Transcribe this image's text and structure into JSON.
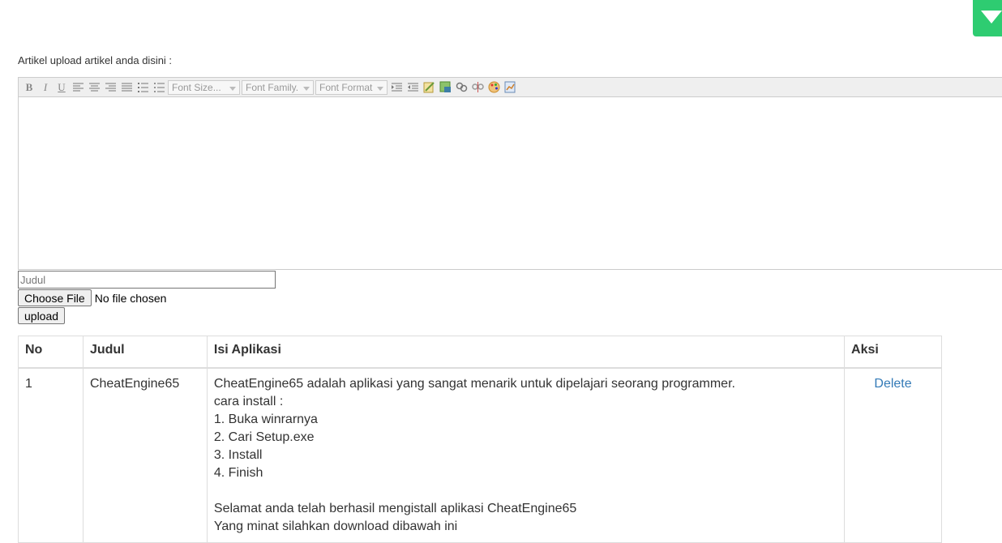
{
  "page": {
    "intro_label": "Artikel upload artikel anda disini :"
  },
  "toolbar": {
    "bold": "B",
    "italic": "I",
    "underline": "U",
    "font_size_placeholder": "Font Size...",
    "font_family_placeholder": "Font Family.",
    "font_format_placeholder": "Font Format"
  },
  "form": {
    "title_placeholder": "Judul",
    "choose_file_label": "Choose File",
    "file_status": "No file chosen",
    "upload_label": "upload"
  },
  "table": {
    "headers": [
      "No",
      "Judul",
      "Isi Aplikasi",
      "Aksi"
    ],
    "rows": [
      {
        "no": "1",
        "judul": "CheatEngine65",
        "isi": [
          "CheatEngine65 adalah aplikasi yang sangat menarik untuk dipelajari seorang programmer.",
          "cara install :",
          "1. Buka winrarnya",
          "2. Cari Setup.exe",
          "3. Install",
          "4. Finish",
          "",
          "Selamat anda telah berhasil mengistall aplikasi CheatEngine65",
          "Yang minat silahkan download dibawah ini"
        ],
        "aksi": "Delete"
      }
    ]
  },
  "colors": {
    "accent_green": "#2ecc71",
    "link_blue": "#337ab7"
  }
}
